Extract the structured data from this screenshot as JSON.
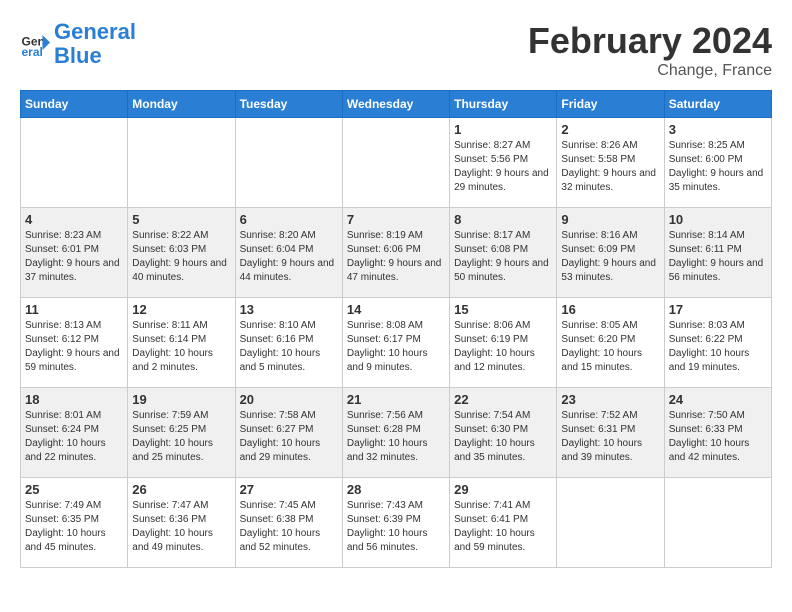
{
  "header": {
    "logo_line1": "General",
    "logo_line2": "Blue",
    "main_title": "February 2024",
    "subtitle": "Change, France"
  },
  "days_of_week": [
    "Sunday",
    "Monday",
    "Tuesday",
    "Wednesday",
    "Thursday",
    "Friday",
    "Saturday"
  ],
  "weeks": [
    [
      {
        "day": "",
        "info": ""
      },
      {
        "day": "",
        "info": ""
      },
      {
        "day": "",
        "info": ""
      },
      {
        "day": "",
        "info": ""
      },
      {
        "day": "1",
        "info": "Sunrise: 8:27 AM\nSunset: 5:56 PM\nDaylight: 9 hours and 29 minutes."
      },
      {
        "day": "2",
        "info": "Sunrise: 8:26 AM\nSunset: 5:58 PM\nDaylight: 9 hours and 32 minutes."
      },
      {
        "day": "3",
        "info": "Sunrise: 8:25 AM\nSunset: 6:00 PM\nDaylight: 9 hours and 35 minutes."
      }
    ],
    [
      {
        "day": "4",
        "info": "Sunrise: 8:23 AM\nSunset: 6:01 PM\nDaylight: 9 hours and 37 minutes."
      },
      {
        "day": "5",
        "info": "Sunrise: 8:22 AM\nSunset: 6:03 PM\nDaylight: 9 hours and 40 minutes."
      },
      {
        "day": "6",
        "info": "Sunrise: 8:20 AM\nSunset: 6:04 PM\nDaylight: 9 hours and 44 minutes."
      },
      {
        "day": "7",
        "info": "Sunrise: 8:19 AM\nSunset: 6:06 PM\nDaylight: 9 hours and 47 minutes."
      },
      {
        "day": "8",
        "info": "Sunrise: 8:17 AM\nSunset: 6:08 PM\nDaylight: 9 hours and 50 minutes."
      },
      {
        "day": "9",
        "info": "Sunrise: 8:16 AM\nSunset: 6:09 PM\nDaylight: 9 hours and 53 minutes."
      },
      {
        "day": "10",
        "info": "Sunrise: 8:14 AM\nSunset: 6:11 PM\nDaylight: 9 hours and 56 minutes."
      }
    ],
    [
      {
        "day": "11",
        "info": "Sunrise: 8:13 AM\nSunset: 6:12 PM\nDaylight: 9 hours and 59 minutes."
      },
      {
        "day": "12",
        "info": "Sunrise: 8:11 AM\nSunset: 6:14 PM\nDaylight: 10 hours and 2 minutes."
      },
      {
        "day": "13",
        "info": "Sunrise: 8:10 AM\nSunset: 6:16 PM\nDaylight: 10 hours and 5 minutes."
      },
      {
        "day": "14",
        "info": "Sunrise: 8:08 AM\nSunset: 6:17 PM\nDaylight: 10 hours and 9 minutes."
      },
      {
        "day": "15",
        "info": "Sunrise: 8:06 AM\nSunset: 6:19 PM\nDaylight: 10 hours and 12 minutes."
      },
      {
        "day": "16",
        "info": "Sunrise: 8:05 AM\nSunset: 6:20 PM\nDaylight: 10 hours and 15 minutes."
      },
      {
        "day": "17",
        "info": "Sunrise: 8:03 AM\nSunset: 6:22 PM\nDaylight: 10 hours and 19 minutes."
      }
    ],
    [
      {
        "day": "18",
        "info": "Sunrise: 8:01 AM\nSunset: 6:24 PM\nDaylight: 10 hours and 22 minutes."
      },
      {
        "day": "19",
        "info": "Sunrise: 7:59 AM\nSunset: 6:25 PM\nDaylight: 10 hours and 25 minutes."
      },
      {
        "day": "20",
        "info": "Sunrise: 7:58 AM\nSunset: 6:27 PM\nDaylight: 10 hours and 29 minutes."
      },
      {
        "day": "21",
        "info": "Sunrise: 7:56 AM\nSunset: 6:28 PM\nDaylight: 10 hours and 32 minutes."
      },
      {
        "day": "22",
        "info": "Sunrise: 7:54 AM\nSunset: 6:30 PM\nDaylight: 10 hours and 35 minutes."
      },
      {
        "day": "23",
        "info": "Sunrise: 7:52 AM\nSunset: 6:31 PM\nDaylight: 10 hours and 39 minutes."
      },
      {
        "day": "24",
        "info": "Sunrise: 7:50 AM\nSunset: 6:33 PM\nDaylight: 10 hours and 42 minutes."
      }
    ],
    [
      {
        "day": "25",
        "info": "Sunrise: 7:49 AM\nSunset: 6:35 PM\nDaylight: 10 hours and 45 minutes."
      },
      {
        "day": "26",
        "info": "Sunrise: 7:47 AM\nSunset: 6:36 PM\nDaylight: 10 hours and 49 minutes."
      },
      {
        "day": "27",
        "info": "Sunrise: 7:45 AM\nSunset: 6:38 PM\nDaylight: 10 hours and 52 minutes."
      },
      {
        "day": "28",
        "info": "Sunrise: 7:43 AM\nSunset: 6:39 PM\nDaylight: 10 hours and 56 minutes."
      },
      {
        "day": "29",
        "info": "Sunrise: 7:41 AM\nSunset: 6:41 PM\nDaylight: 10 hours and 59 minutes."
      },
      {
        "day": "",
        "info": ""
      },
      {
        "day": "",
        "info": ""
      }
    ]
  ]
}
